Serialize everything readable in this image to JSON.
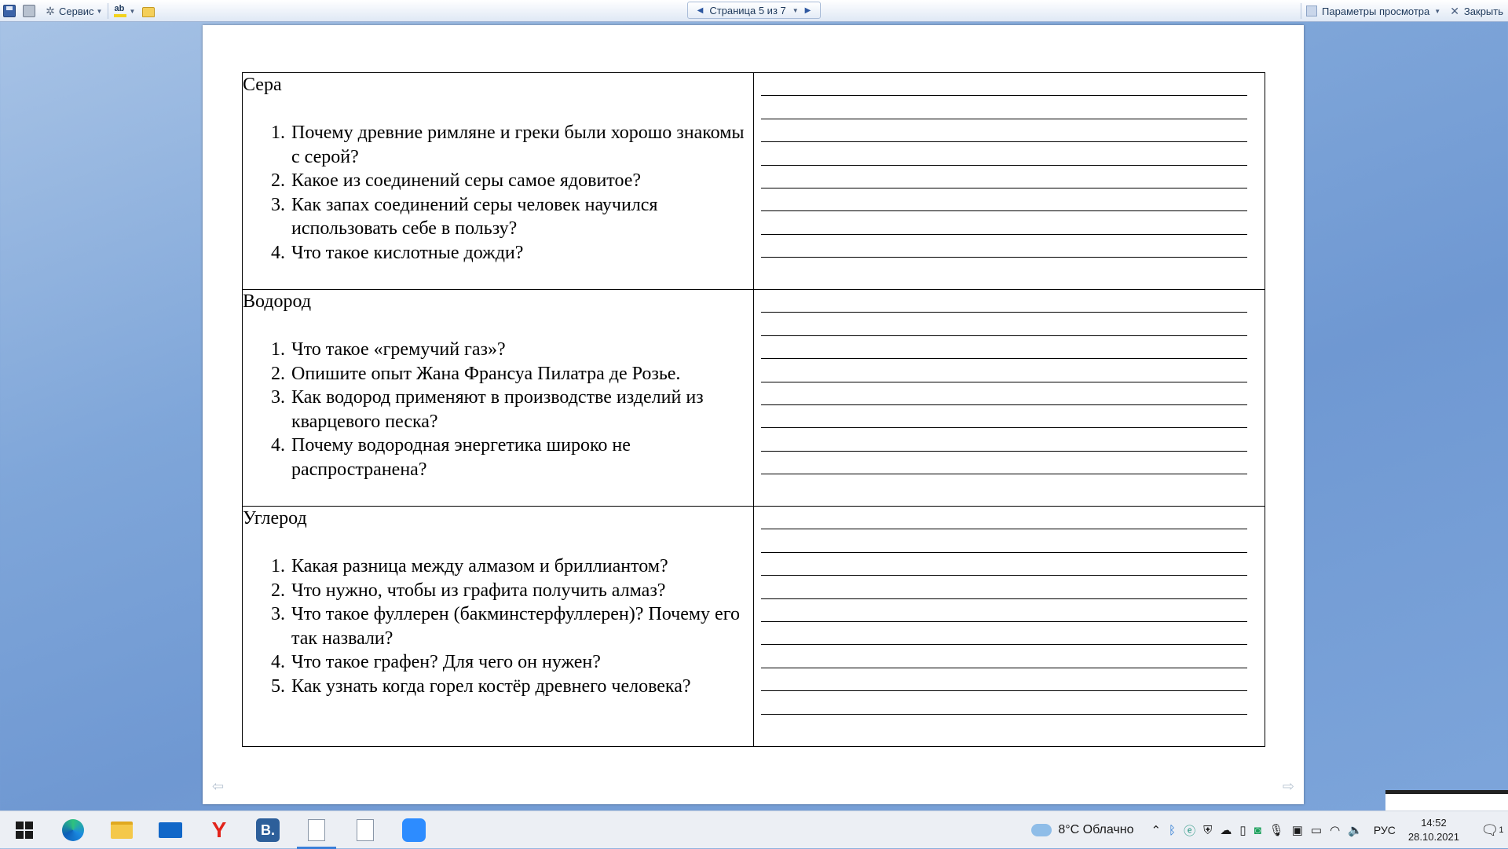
{
  "toolbar": {
    "service_label": "Сервис",
    "page_nav": "Страница 5 из 7",
    "view_params_label": "Параметры просмотра",
    "close_label": "Закрыть"
  },
  "document": {
    "sections": [
      {
        "heading": "Сера",
        "questions": [
          "Почему древние римляне и греки были хорошо знакомы с серой?",
          "Какое из соединений серы самое ядовитое?",
          "Как запах соединений серы человек научился использовать себе в пользу?",
          "Что такое кислотные дожди?"
        ]
      },
      {
        "heading": "Водород",
        "questions": [
          "Что такое «гремучий газ»?",
          "Опишите опыт Жана Франсуа Пилатра де Розье.",
          "Как водород применяют в производстве изделий из кварцевого песка?",
          "Почему водородная энергетика широко не распространена?"
        ]
      },
      {
        "heading": "Углерод",
        "questions": [
          "Какая разница между алмазом и бриллиантом?",
          "Что нужно, чтобы из графита получить алмаз?",
          "Что такое фуллерен (бакминстерфуллерен)? Почему его так назвали?",
          "Что такое графен? Для чего он нужен?",
          "Как узнать когда горел костёр древнего человека?"
        ]
      }
    ]
  },
  "taskbar": {
    "apps": [
      "windows-start-icon",
      "edge-icon",
      "file-explorer-icon",
      "mail-icon",
      "yandex-browser-icon",
      "vk-icon",
      "word-document-icon",
      "document-icon",
      "zoom-icon"
    ],
    "vk_letter": "B.",
    "yandex_letter": "Y",
    "weather": "8°C  Облачно",
    "lang": "РУС",
    "time": "14:52",
    "date": "28.10.2021",
    "notifications": "1"
  }
}
